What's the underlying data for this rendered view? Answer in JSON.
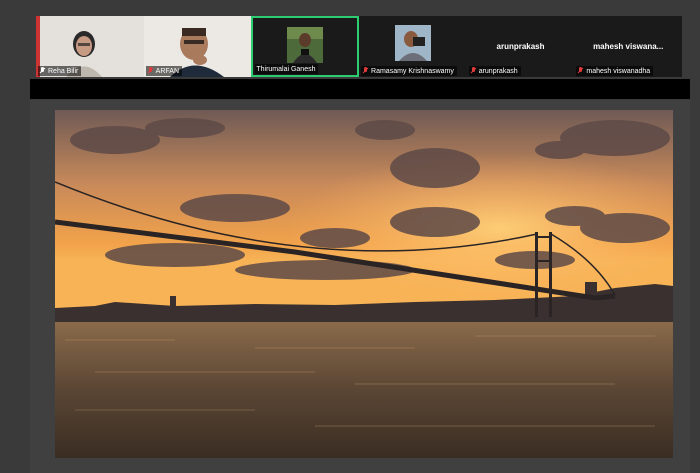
{
  "participants": [
    {
      "name": "Reha Bilir",
      "muted": true,
      "mic_color": "white",
      "video": true
    },
    {
      "name": "ARFAN",
      "muted": true,
      "mic_color": "red",
      "video": true
    },
    {
      "name": "Thirumalai Ganesh",
      "muted": false,
      "video": true,
      "active": true
    },
    {
      "name": "Ramasamy Krishnaswamy",
      "muted": true,
      "mic_color": "red",
      "video": false
    },
    {
      "name": "arunprakash",
      "display_name": "arunprakash",
      "muted": true,
      "mic_color": "red",
      "video": false
    },
    {
      "name": "mahesh viswanadha",
      "display_name": "mahesh viswana...",
      "muted": true,
      "mic_color": "red",
      "video": false
    }
  ],
  "shared_content": {
    "type": "photo",
    "subject": "suspension bridge over water at sunset"
  },
  "colors": {
    "background": "#3a3a3a",
    "active_speaker_border": "#2ecc71",
    "muted_mic": "#e23b3b"
  }
}
